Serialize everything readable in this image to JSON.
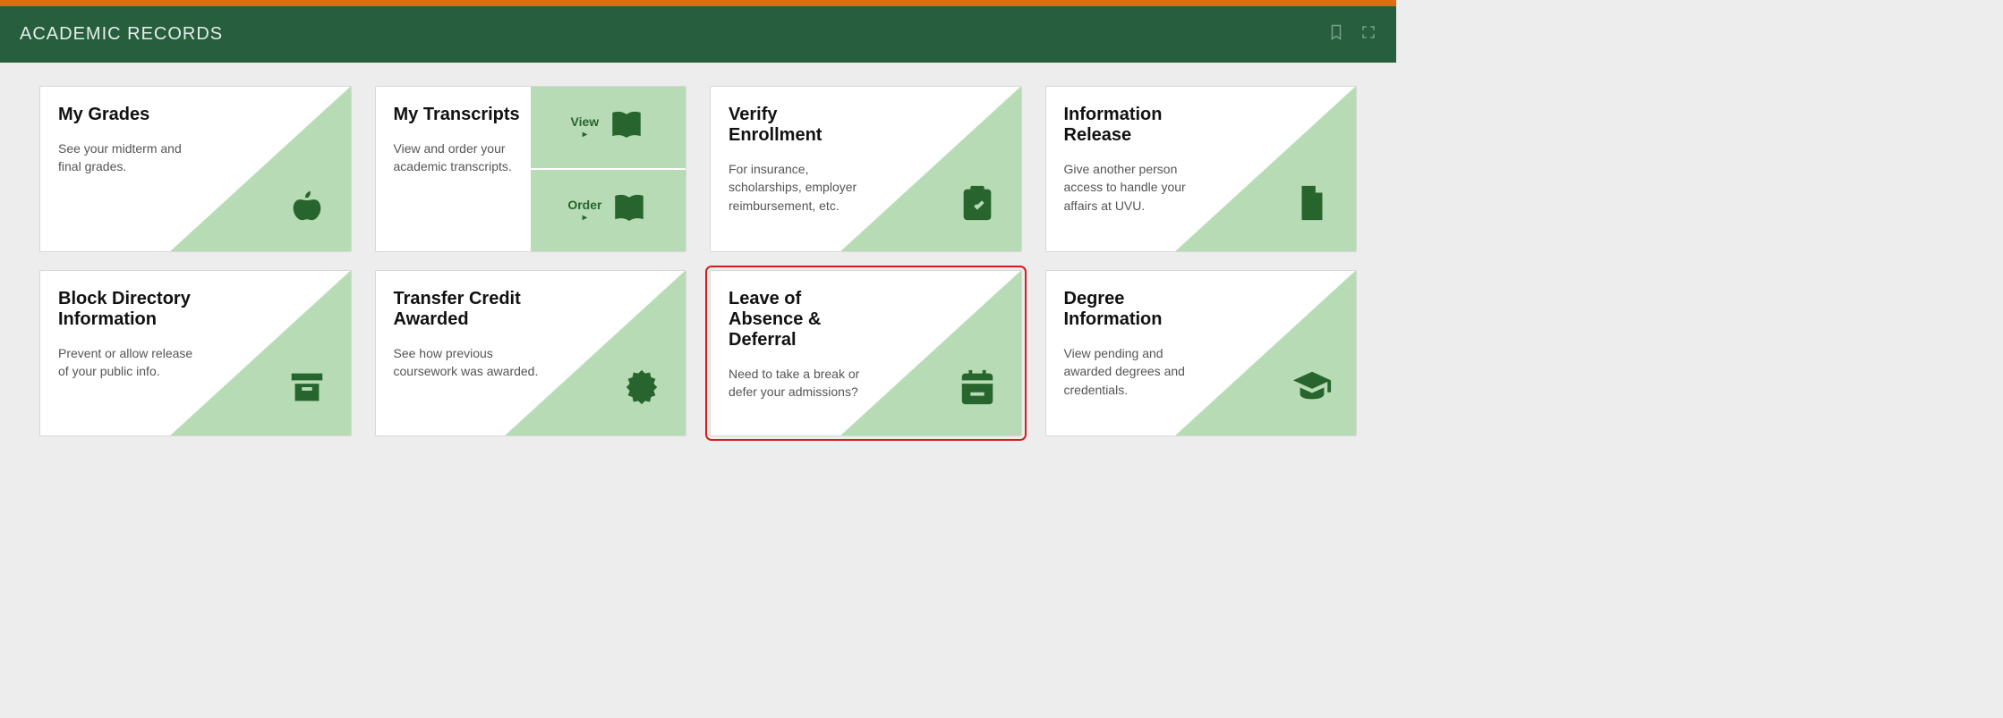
{
  "header": {
    "title": "ACADEMIC RECORDS"
  },
  "cards": {
    "grades": {
      "title": "My Grades",
      "desc": "See your midterm and final grades."
    },
    "transcripts": {
      "title": "My Transcripts",
      "desc": "View and order your academic transcripts.",
      "view": "View",
      "order": "Order"
    },
    "verify": {
      "title": "Verify Enrollment",
      "desc": "For insurance, scholarships, employer reimbursement, etc."
    },
    "inforelease": {
      "title": "Information Release",
      "desc": "Give another person access to handle your affairs at UVU."
    },
    "blockdir": {
      "title": "Block Directory Information",
      "desc": "Prevent or allow release of your public info."
    },
    "transfer": {
      "title": "Transfer Credit Awarded",
      "desc": "See how previous coursework was awarded."
    },
    "leave": {
      "title": "Leave of Absence & Deferral",
      "desc": "Need to take a break or defer your admissions?"
    },
    "degree": {
      "title": "Degree Information",
      "desc": "View pending and awarded degrees and credentials."
    }
  }
}
